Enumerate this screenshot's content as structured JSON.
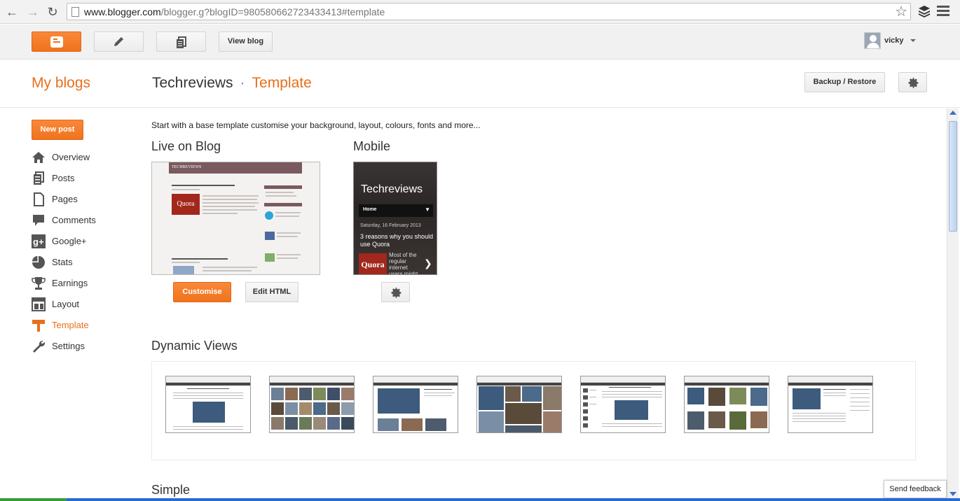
{
  "browser": {
    "url_host": "www.blogger.com",
    "url_path": "/blogger.g?blogID=980580662723433413#template"
  },
  "header": {
    "view_blog_label": "View blog",
    "user_name": "vicky"
  },
  "title_row": {
    "my_blogs": "My blogs",
    "blog_name": "Techreviews",
    "separator": "·",
    "page_name": "Template",
    "backup_label": "Backup / Restore"
  },
  "sidebar": {
    "new_post_label": "New post",
    "items": [
      {
        "label": "Overview",
        "icon": "home-icon"
      },
      {
        "label": "Posts",
        "icon": "posts-icon"
      },
      {
        "label": "Pages",
        "icon": "pages-icon"
      },
      {
        "label": "Comments",
        "icon": "comments-icon"
      },
      {
        "label": "Google+",
        "icon": "google-plus-icon"
      },
      {
        "label": "Stats",
        "icon": "stats-icon"
      },
      {
        "label": "Earnings",
        "icon": "trophy-icon"
      },
      {
        "label": "Layout",
        "icon": "layout-icon"
      },
      {
        "label": "Template",
        "icon": "template-icon",
        "active": true
      },
      {
        "label": "Settings",
        "icon": "wrench-icon"
      }
    ]
  },
  "main": {
    "intro": "Start with a base template customise your background, layout, colours, fonts and more...",
    "live_heading": "Live on Blog",
    "mobile_heading": "Mobile",
    "customise_label": "Customise",
    "edit_html_label": "Edit HTML",
    "dynamic_heading": "Dynamic Views",
    "simple_heading": "Simple"
  },
  "live_preview": {
    "blog_title": "TECHREVIEWS",
    "badge": "Quora"
  },
  "mobile_preview": {
    "title": "Techreviews",
    "nav_label": "Home",
    "date": "Saturday, 16 February 2013",
    "post_title": "3 reasons why you should use Quora",
    "badge": "Quora",
    "excerpt": "Most of the regular internet users might know"
  },
  "feedback_label": "Send feedback",
  "colors": {
    "accent": "#e86f1c",
    "button_orange": "#f0731c"
  }
}
